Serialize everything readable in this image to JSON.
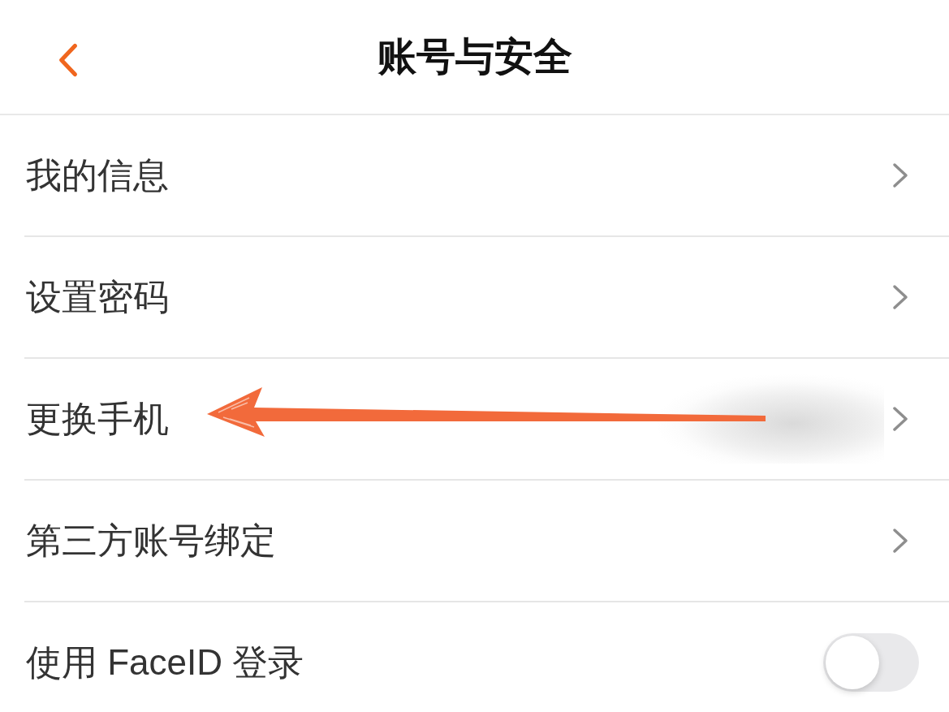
{
  "header": {
    "title": "账号与安全"
  },
  "rows": [
    {
      "kind": "link",
      "label": "我的信息",
      "redacted_value": false,
      "arrow_annotation": false
    },
    {
      "kind": "link",
      "label": "设置密码",
      "redacted_value": false,
      "arrow_annotation": false
    },
    {
      "kind": "link",
      "label": "更换手机",
      "redacted_value": true,
      "arrow_annotation": true
    },
    {
      "kind": "link",
      "label": "第三方账号绑定",
      "redacted_value": false,
      "arrow_annotation": false
    },
    {
      "kind": "toggle",
      "label": "使用 FaceID 登录",
      "on": false
    }
  ]
}
